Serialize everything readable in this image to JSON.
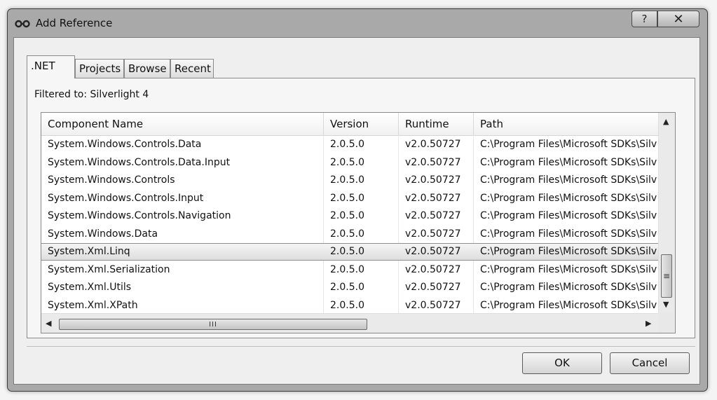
{
  "window": {
    "title": "Add Reference",
    "icon": "glasses-icon",
    "help_glyph": "?",
    "close_glyph": "✕"
  },
  "tabs": [
    {
      "label": ".NET",
      "active": true
    },
    {
      "label": "Projects",
      "active": false
    },
    {
      "label": "Browse",
      "active": false
    },
    {
      "label": "Recent",
      "active": false
    }
  ],
  "filter_text": "Filtered to: Silverlight 4",
  "list": {
    "columns": [
      "Component Name",
      "Version",
      "Runtime",
      "Path"
    ],
    "rows": [
      [
        "System.Windows.Controls.Data",
        "2.0.5.0",
        "v2.0.50727",
        "C:\\Program Files\\Microsoft SDKs\\Silv"
      ],
      [
        "System.Windows.Controls.Data.Input",
        "2.0.5.0",
        "v2.0.50727",
        "C:\\Program Files\\Microsoft SDKs\\Silv"
      ],
      [
        "System.Windows.Controls",
        "2.0.5.0",
        "v2.0.50727",
        "C:\\Program Files\\Microsoft SDKs\\Silv"
      ],
      [
        "System.Windows.Controls.Input",
        "2.0.5.0",
        "v2.0.50727",
        "C:\\Program Files\\Microsoft SDKs\\Silv"
      ],
      [
        "System.Windows.Controls.Navigation",
        "2.0.5.0",
        "v2.0.50727",
        "C:\\Program Files\\Microsoft SDKs\\Silv"
      ],
      [
        "System.Windows.Data",
        "2.0.5.0",
        "v2.0.50727",
        "C:\\Program Files\\Microsoft SDKs\\Silv"
      ],
      [
        "System.Xml.Linq",
        "2.0.5.0",
        "v2.0.50727",
        "C:\\Program Files\\Microsoft SDKs\\Silv"
      ],
      [
        "System.Xml.Serialization",
        "2.0.5.0",
        "v2.0.50727",
        "C:\\Program Files\\Microsoft SDKs\\Silv"
      ],
      [
        "System.Xml.Utils",
        "2.0.5.0",
        "v2.0.50727",
        "C:\\Program Files\\Microsoft SDKs\\Silv"
      ],
      [
        "System.Xml.XPath",
        "2.0.5.0",
        "v2.0.50727",
        "C:\\Program Files\\Microsoft SDKs\\Silv"
      ]
    ],
    "selected_index": 6,
    "scroll": {
      "up": "▲",
      "down": "▼",
      "left": "◀",
      "right": "▶",
      "v_grip": "≡",
      "h_grip": "III"
    }
  },
  "buttons": {
    "ok": "OK",
    "cancel": "Cancel"
  }
}
